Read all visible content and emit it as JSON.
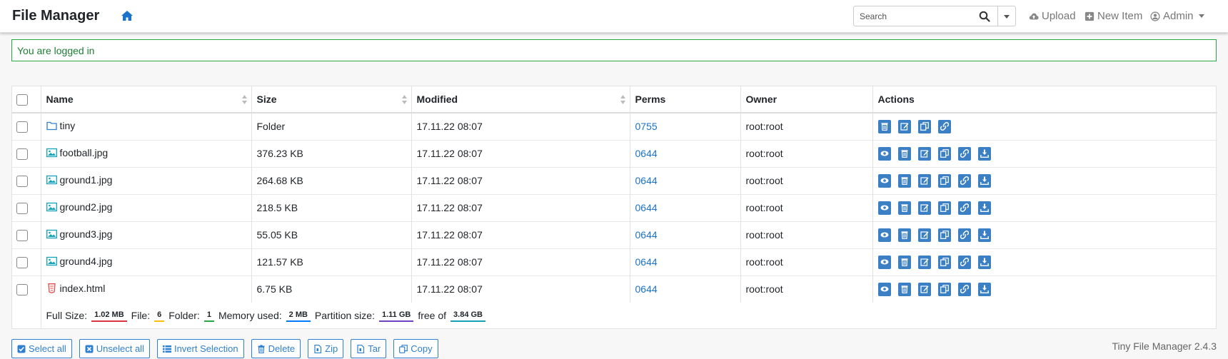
{
  "app": {
    "title": "File Manager",
    "version": "Tiny File Manager 2.4.3"
  },
  "search": {
    "placeholder": "Search"
  },
  "nav": {
    "upload": "Upload",
    "new_item": "New Item",
    "admin": "Admin"
  },
  "alert": {
    "message": "You are logged in"
  },
  "table": {
    "headers": {
      "name": "Name",
      "size": "Size",
      "modified": "Modified",
      "perms": "Perms",
      "owner": "Owner",
      "actions": "Actions"
    },
    "rows": [
      {
        "name": "tiny",
        "type": "folder",
        "size": "Folder",
        "modified": "17.11.22 08:07",
        "perms": "0755",
        "owner": "root:root"
      },
      {
        "name": "football.jpg",
        "type": "image",
        "size": "376.23 KB",
        "modified": "17.11.22 08:07",
        "perms": "0644",
        "owner": "root:root"
      },
      {
        "name": "ground1.jpg",
        "type": "image",
        "size": "264.68 KB",
        "modified": "17.11.22 08:07",
        "perms": "0644",
        "owner": "root:root"
      },
      {
        "name": "ground2.jpg",
        "type": "image",
        "size": "218.5 KB",
        "modified": "17.11.22 08:07",
        "perms": "0644",
        "owner": "root:root"
      },
      {
        "name": "ground3.jpg",
        "type": "image",
        "size": "55.05 KB",
        "modified": "17.11.22 08:07",
        "perms": "0644",
        "owner": "root:root"
      },
      {
        "name": "ground4.jpg",
        "type": "image",
        "size": "121.57 KB",
        "modified": "17.11.22 08:07",
        "perms": "0644",
        "owner": "root:root"
      },
      {
        "name": "index.html",
        "type": "html",
        "size": "6.75 KB",
        "modified": "17.11.22 08:07",
        "perms": "0644",
        "owner": "root:root"
      }
    ]
  },
  "stats": {
    "full_size_label": "Full Size:",
    "full_size": "1.02 MB",
    "file_label": "File:",
    "file_count": "6",
    "folder_label": "Folder:",
    "folder_count": "1",
    "memory_label": "Memory used:",
    "memory": "2 MB",
    "partition_label": "Partition size:",
    "partition": "1.11 GB",
    "free_label": "free of",
    "total": "3.84 GB"
  },
  "buttons": {
    "select_all": "Select all",
    "unselect_all": "Unselect all",
    "invert": "Invert Selection",
    "delete": "Delete",
    "zip": "Zip",
    "tar": "Tar",
    "copy": "Copy"
  },
  "colors": {
    "accent": "#2f80d1",
    "action_bg": "#3b7fc4",
    "alert_green": "#28a745",
    "image_icon": "#17a2b8",
    "html_icon": "#e34c4c"
  }
}
